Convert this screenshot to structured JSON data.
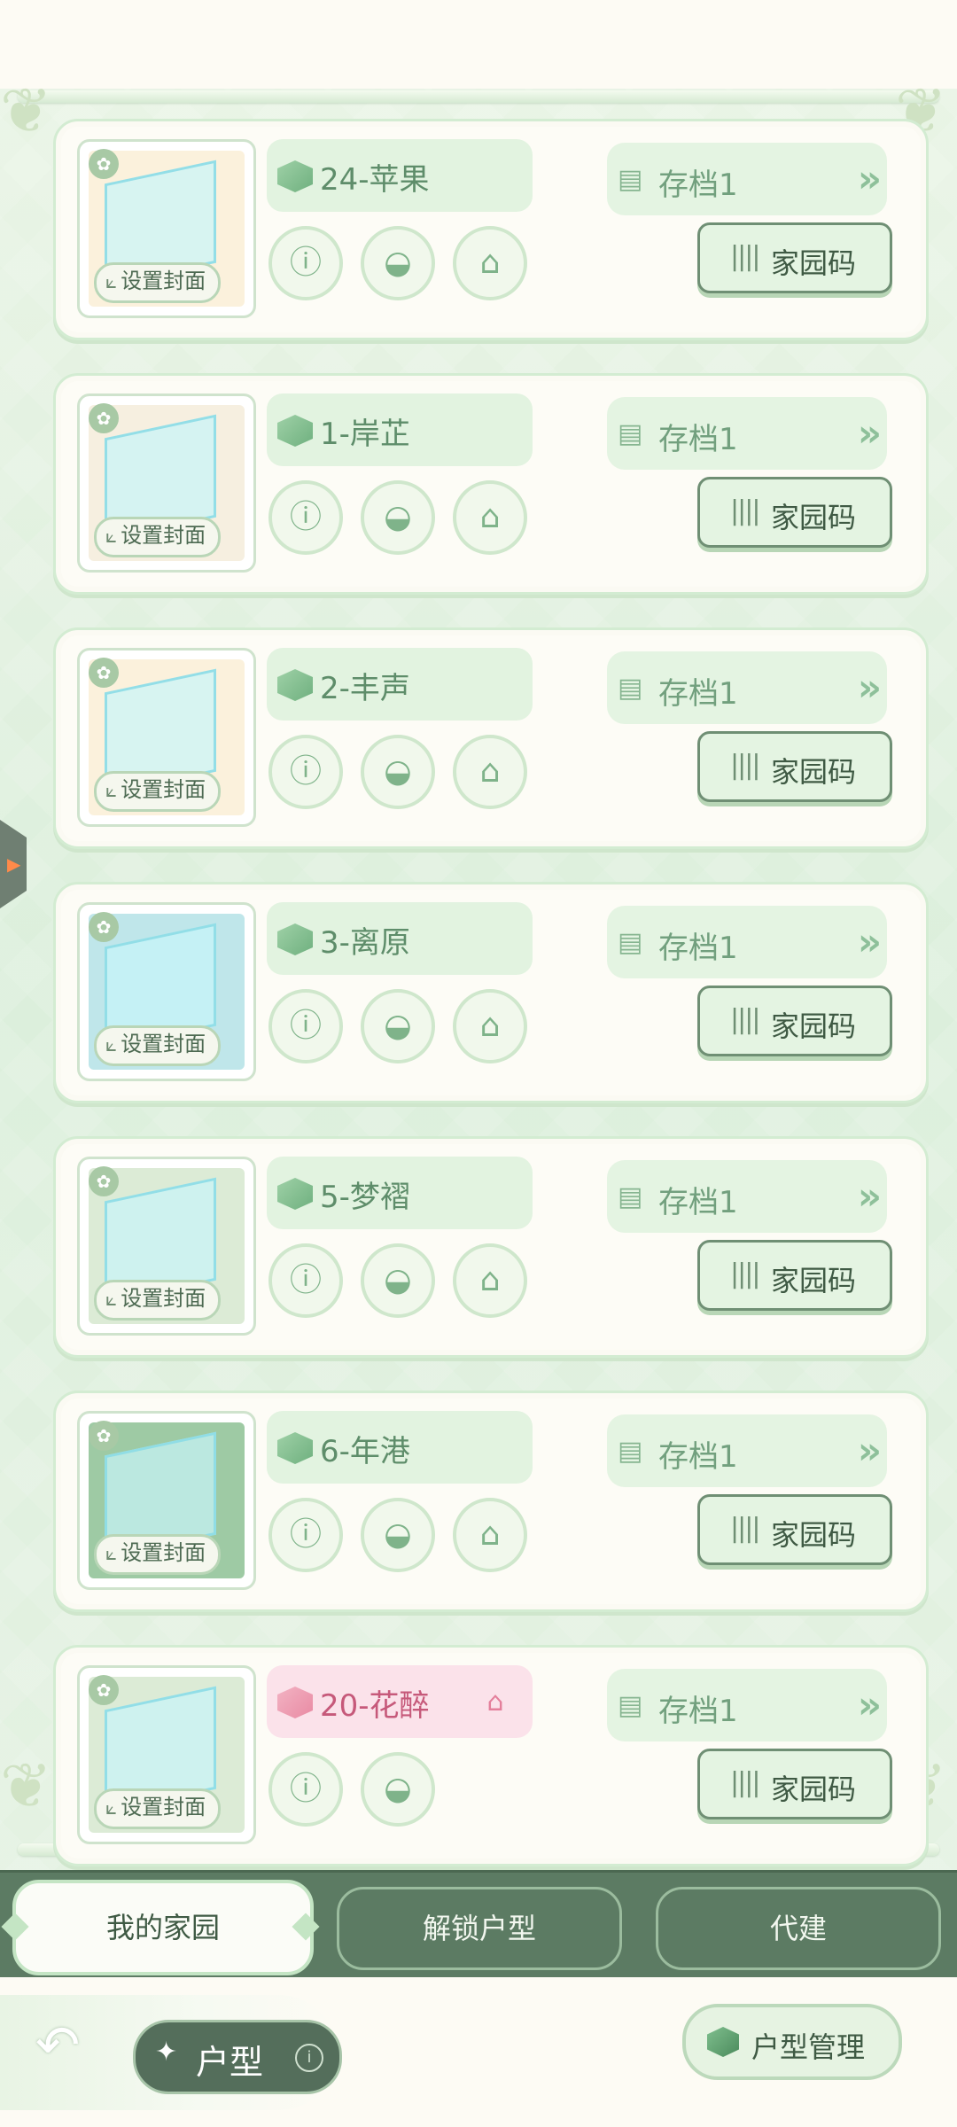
{
  "homes": [
    {
      "name": "24-苹果",
      "save": "存档1",
      "cover_label": "设置封面",
      "code_label": "家园码",
      "thumb_bg": "#fbf1dc",
      "special": false
    },
    {
      "name": "1-岸芷",
      "save": "存档1",
      "cover_label": "设置封面",
      "code_label": "家园码",
      "thumb_bg": "#f6efe0",
      "special": false
    },
    {
      "name": "2-丰声",
      "save": "存档1",
      "cover_label": "设置封面",
      "code_label": "家园码",
      "thumb_bg": "#fbf1dc",
      "special": false
    },
    {
      "name": "3-离原",
      "save": "存档1",
      "cover_label": "设置封面",
      "code_label": "家园码",
      "thumb_bg": "#bfe6ea",
      "special": false
    },
    {
      "name": "5-梦褶",
      "save": "存档1",
      "cover_label": "设置封面",
      "code_label": "家园码",
      "thumb_bg": "#dcebd6",
      "special": false
    },
    {
      "name": "6-年港",
      "save": "存档1",
      "cover_label": "设置封面",
      "code_label": "家园码",
      "thumb_bg": "#9ecaa4",
      "special": false
    },
    {
      "name": "20-花醉",
      "save": "存档1",
      "cover_label": "设置封面",
      "code_label": "家园码",
      "thumb_bg": "#dcebd6",
      "special": true
    }
  ],
  "tabs": [
    {
      "label": "我的家园",
      "active": true
    },
    {
      "label": "解锁户型",
      "active": false
    },
    {
      "label": "代建",
      "active": false
    }
  ],
  "footer": {
    "title": "户型",
    "manage_label": "户型管理"
  },
  "icons": {
    "info": "ⓘ",
    "bread": "◒",
    "home": "⌂",
    "save": "▤",
    "arrow": "»",
    "barcode": "||||",
    "back": "↶",
    "foot": "✿",
    "crop": "⟀"
  },
  "colors": {
    "accent_green": "#5c7b63",
    "pink": "#e98aa3"
  }
}
